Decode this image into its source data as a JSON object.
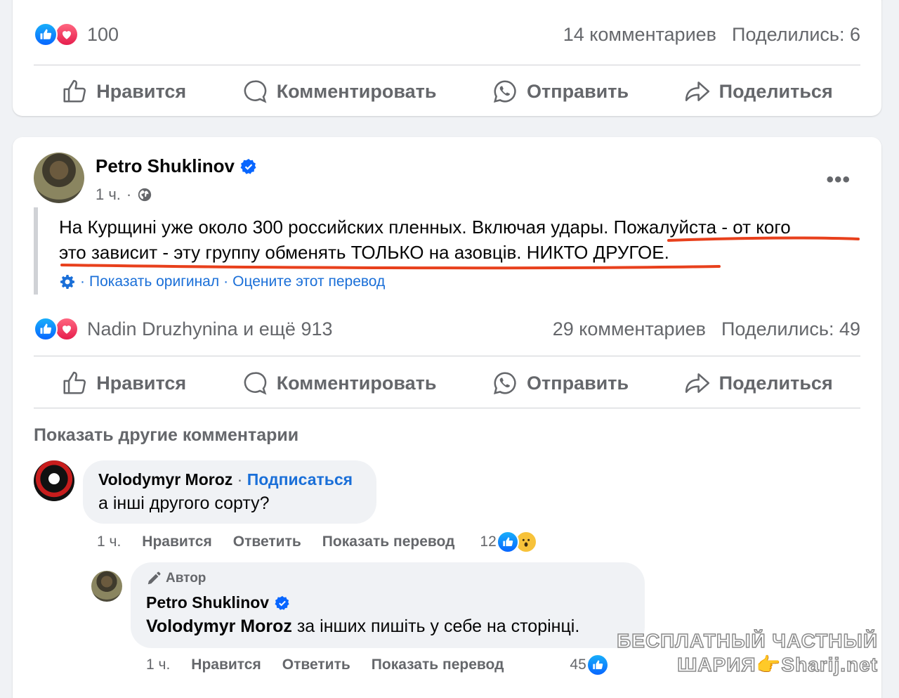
{
  "prev_post": {
    "reaction_count": "100",
    "comments": "14 комментариев",
    "shares": "Поделились: 6"
  },
  "actions": {
    "like": "Нравится",
    "comment": "Комментировать",
    "send": "Отправить",
    "share": "Поделиться"
  },
  "post": {
    "author": "Petro Shuklinov",
    "time": "1 ч.",
    "text_line1": "На Курщині уже около 300 российских пленных. Включая удары. Пожалуйста - от кого",
    "text_line2": "это зависит - эту группу обменять ТОЛЬКО на азовців. НИКТО ДРУГОЕ.",
    "show_original": "Показать оригинал",
    "rate_translation": "Оцените этот перевод",
    "reactions": "Nadin Druzhynina и ещё 913",
    "comments": "29 комментариев",
    "shares": "Поделились: 49"
  },
  "show_more_comments": "Показать другие комментарии",
  "comment1": {
    "author": "Volodymyr Moroz",
    "follow": "Подписаться",
    "text": "а інші другого сорту?",
    "time": "1 ч.",
    "like": "Нравится",
    "reply": "Ответить",
    "translate": "Показать перевод",
    "reaction_count": "12"
  },
  "reply1": {
    "tag": "Автор",
    "author": "Petro Shuklinov",
    "mention": "Volodymyr Moroz",
    "text": " за інших пишіть у себе на сторінці.",
    "time": "1 ч.",
    "like": "Нравится",
    "reply": "Ответить",
    "translate": "Показать перевод",
    "reaction_count": "45"
  },
  "watermark": {
    "line1": "БЕСПЛАТНЫЙ ЧАСТНЫЙ",
    "line2": "ШАРИЯ👉Sharij.net"
  },
  "colors": {
    "accent": "#1a6fd8",
    "underline": "#e8401c",
    "muted": "#65676b"
  }
}
